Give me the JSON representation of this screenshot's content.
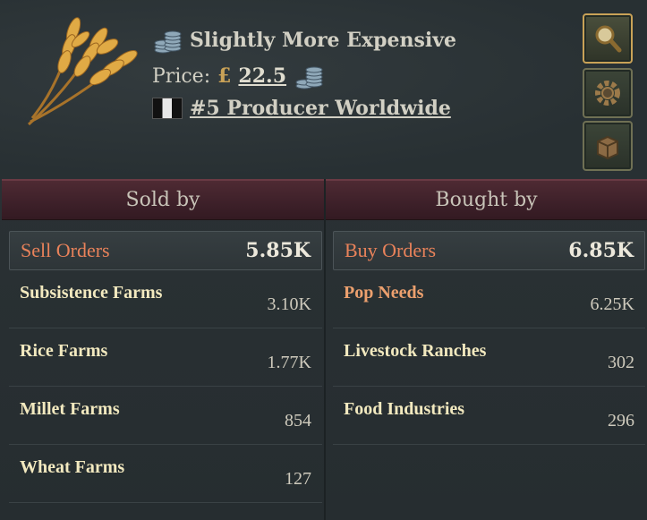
{
  "header": {
    "price_trend": "Slightly More Expensive",
    "price_label": "Price:",
    "currency_symbol": "£",
    "price_value": "22.5",
    "producer_rank": "#5 Producer Worldwide",
    "goods_icon": "wheat-icon",
    "buttons": [
      {
        "icon": "magnifier-icon",
        "active": true
      },
      {
        "icon": "gear-icon",
        "active": false
      },
      {
        "icon": "crate-icon",
        "active": false
      }
    ]
  },
  "sold": {
    "title": "Sold by",
    "orders_label": "Sell Orders",
    "orders_total": "5.85K",
    "items": [
      {
        "name": "Subsistence Farms",
        "value": "3.10K"
      },
      {
        "name": "Rice Farms",
        "value": "1.77K"
      },
      {
        "name": "Millet Farms",
        "value": "854"
      },
      {
        "name": "Wheat Farms",
        "value": "127"
      }
    ]
  },
  "bought": {
    "title": "Bought by",
    "orders_label": "Buy Orders",
    "orders_total": "6.85K",
    "items": [
      {
        "name": "Pop Needs",
        "value": "6.25K"
      },
      {
        "name": "Livestock Ranches",
        "value": "302"
      },
      {
        "name": "Food Industries",
        "value": "296"
      }
    ]
  },
  "colors": {
    "accent_orange": "#e8825a",
    "name_cream": "#f2e9bf",
    "header_maroon": "#4e2a33",
    "gold": "#c9a257"
  }
}
